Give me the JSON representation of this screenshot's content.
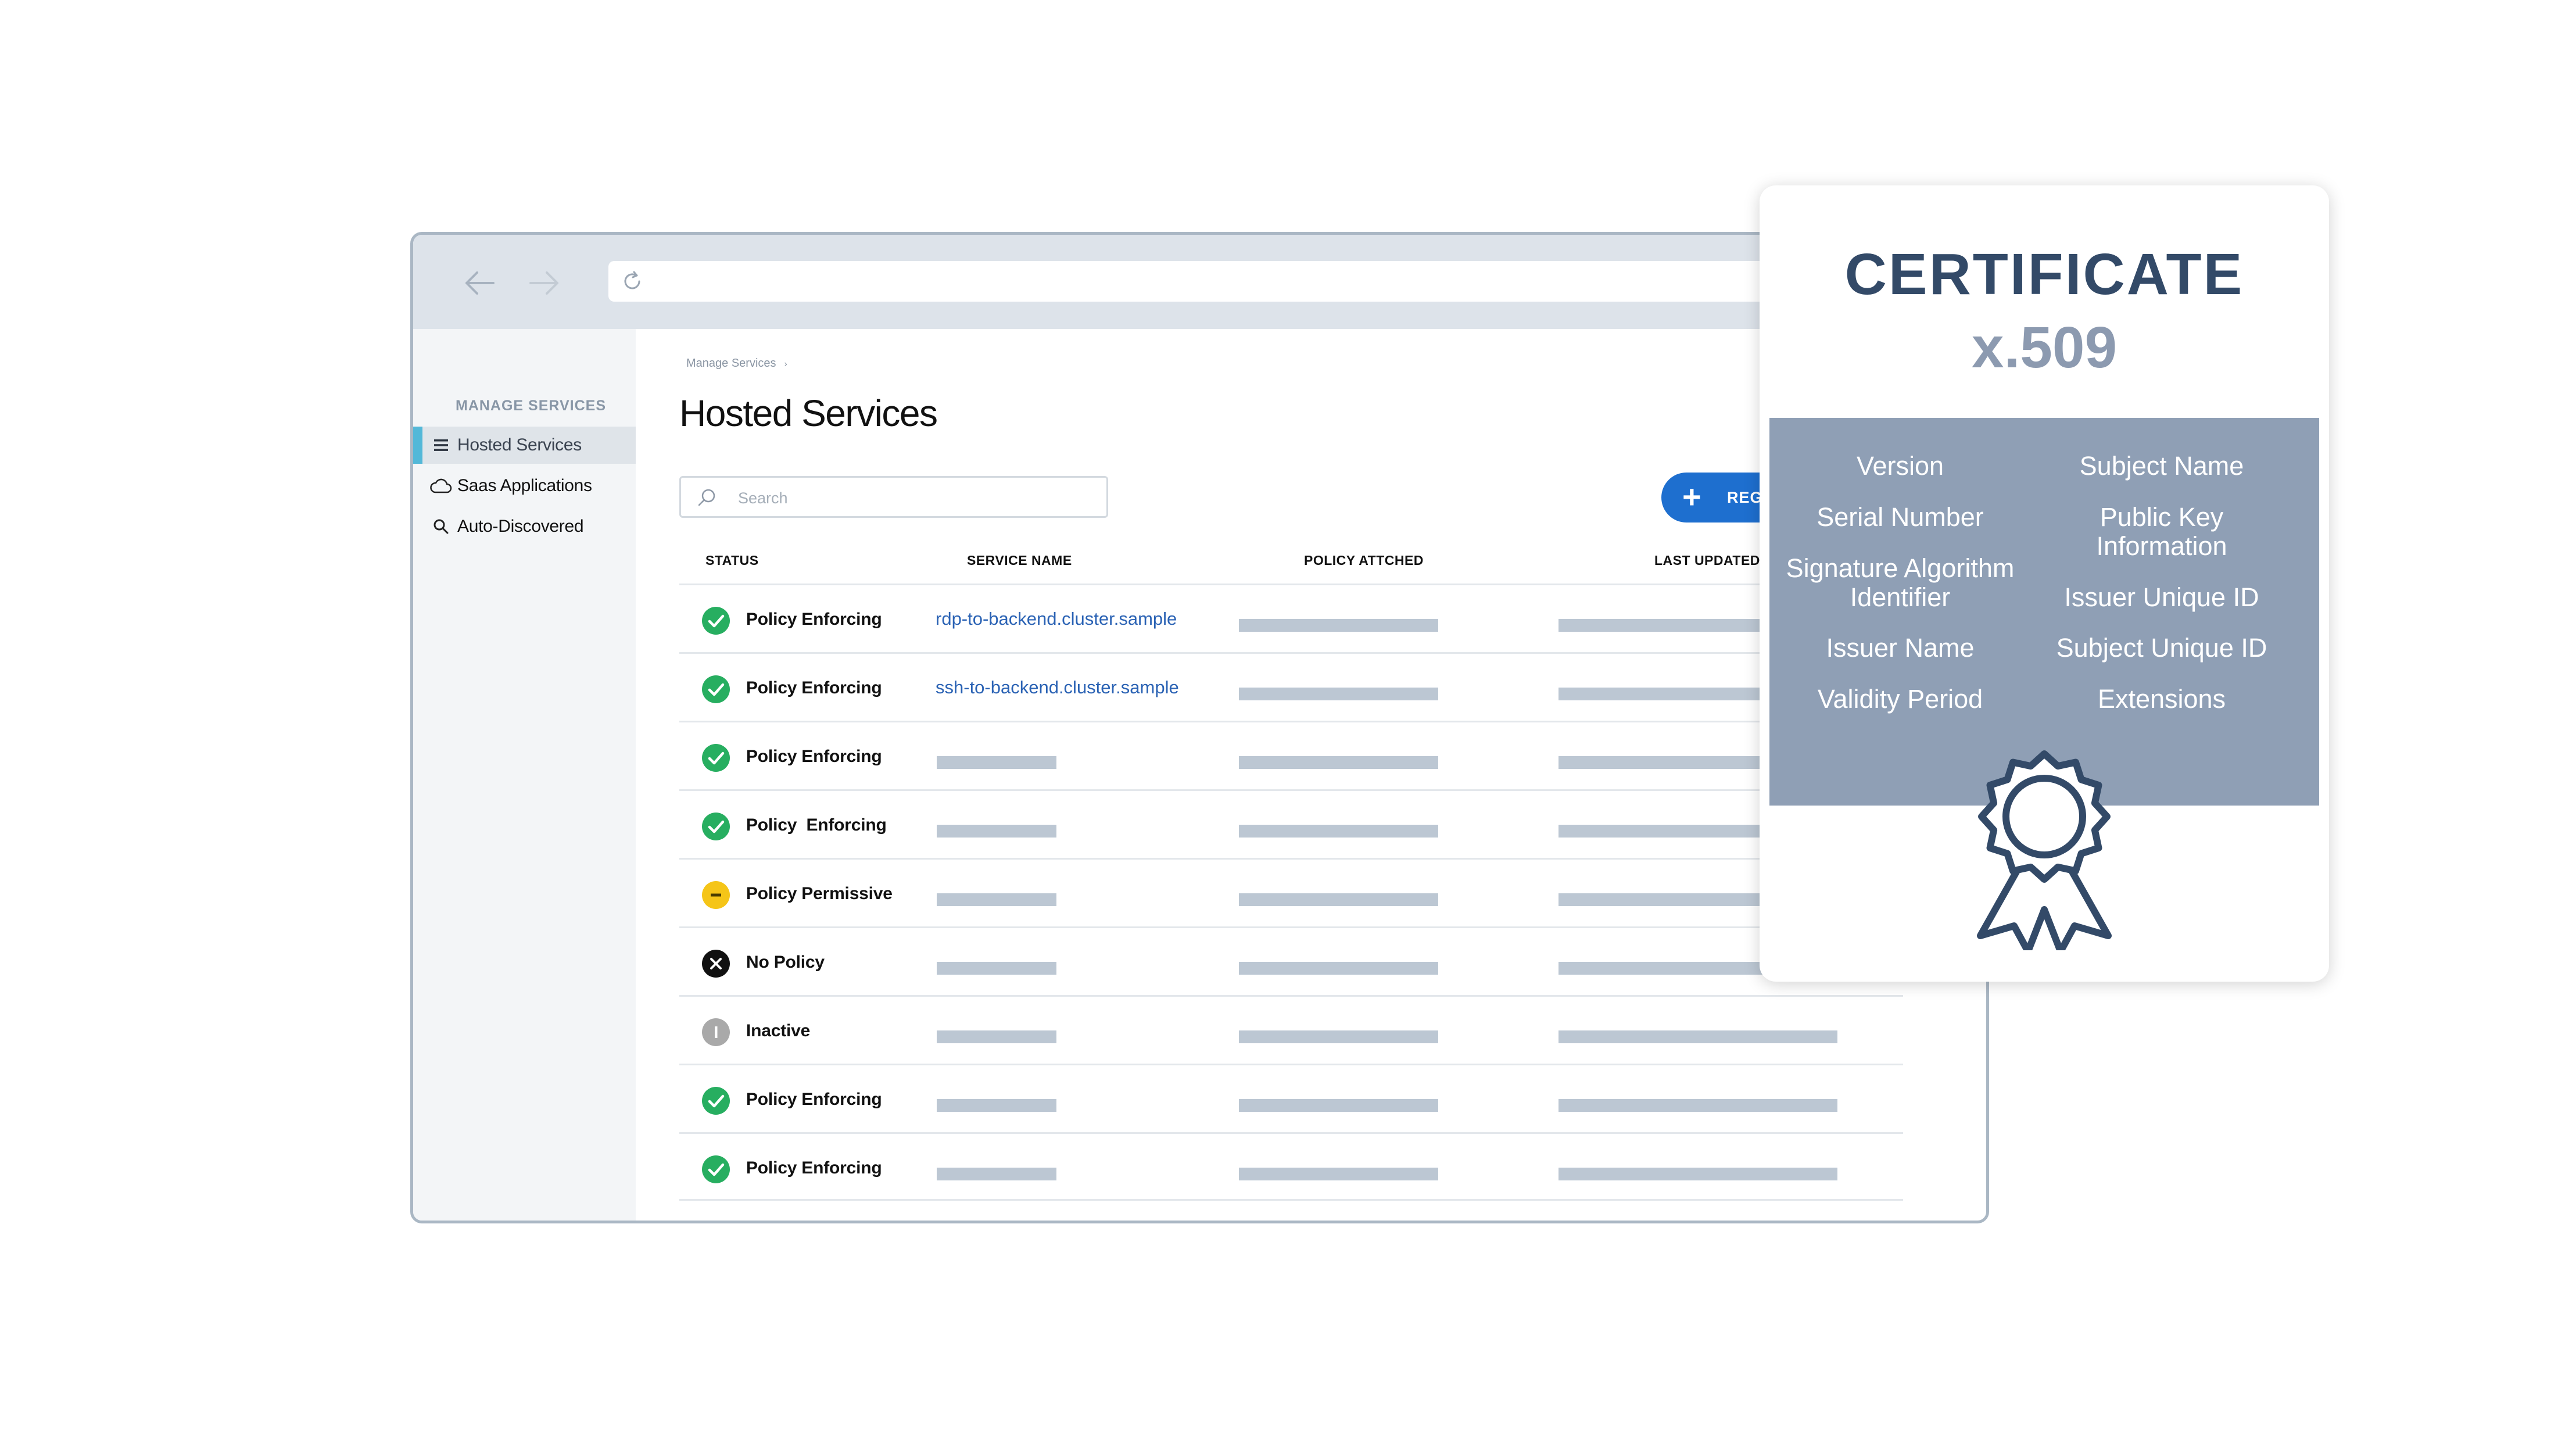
{
  "sidebar": {
    "heading": "MANAGE SERVICES",
    "items": [
      {
        "label": "Hosted Services",
        "icon": "list-icon",
        "active": true
      },
      {
        "label": "Saas Applications",
        "icon": "cloud-icon",
        "active": false
      },
      {
        "label": "Auto-Discovered",
        "icon": "search-icon",
        "active": false
      }
    ]
  },
  "breadcrumb": {
    "label": "Manage Services",
    "arrow": "›"
  },
  "page": {
    "title": "Hosted Services"
  },
  "search": {
    "placeholder": "Search"
  },
  "register_button": {
    "label": "REG"
  },
  "table": {
    "columns": {
      "status": "STATUS",
      "service": "SERVICE NAME",
      "policy": "POLICY ATTCHED",
      "updated": "LAST UPDATED"
    },
    "rows": [
      {
        "status": "Policy Enforcing",
        "status_type": "enforcing",
        "service": "rdp-to-backend.cluster.sample"
      },
      {
        "status": "Policy Enforcing",
        "status_type": "enforcing",
        "service": "ssh-to-backend.cluster.sample"
      },
      {
        "status": "Policy Enforcing",
        "status_type": "enforcing",
        "service": ""
      },
      {
        "status": "Policy  Enforcing",
        "status_type": "enforcing",
        "service": ""
      },
      {
        "status": "Policy Permissive",
        "status_type": "permissive",
        "service": ""
      },
      {
        "status": "No Policy",
        "status_type": "none",
        "service": ""
      },
      {
        "status": "Inactive",
        "status_type": "inactive",
        "service": ""
      },
      {
        "status": "Policy Enforcing",
        "status_type": "enforcing",
        "service": ""
      },
      {
        "status": "Policy Enforcing",
        "status_type": "enforcing",
        "service": ""
      }
    ]
  },
  "certificate": {
    "title": "CERTIFICATE",
    "subtitle": "x.509",
    "fields_left": [
      "Version",
      "Serial Number",
      "Signature Algorithm Identifier",
      "Issuer Name",
      "Validity Period"
    ],
    "fields_right": [
      "Subject Name",
      "Public Key Information",
      "Issuer Unique ID",
      "Subject Unique ID",
      "Extensions"
    ],
    "icon": "award-ribbon-icon"
  },
  "colors": {
    "accent": "#1e6fcf",
    "link": "#2a62b4",
    "enforcing": "#27ae60",
    "permissive": "#f5c518",
    "no_policy": "#111111",
    "inactive": "#a9a9a9",
    "sidebar_active": "#53b8d8",
    "cert_title": "#334a68",
    "cert_panel": "#8f9fb5"
  }
}
